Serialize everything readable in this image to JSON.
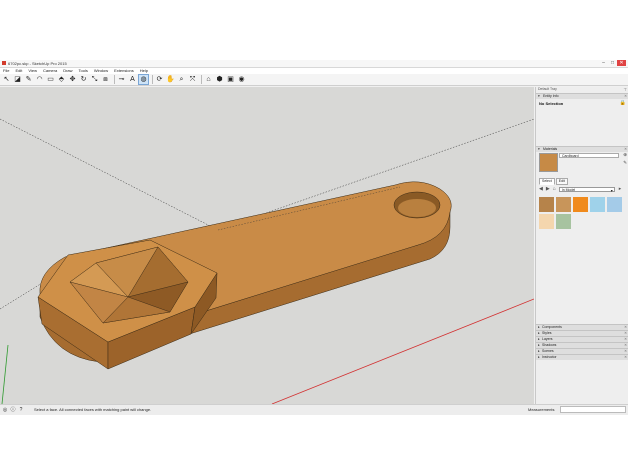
{
  "window": {
    "title": "6702pc.skp - SketchUp Pro 2015",
    "minimize": "–",
    "maximize": "□",
    "close": "✕"
  },
  "menu": [
    "File",
    "Edit",
    "View",
    "Camera",
    "Draw",
    "Tools",
    "Window",
    "Extensions",
    "Help"
  ],
  "toolbar": {
    "tools": [
      {
        "icon": "select-arrow-icon",
        "glyph": "↖"
      },
      {
        "icon": "eraser-icon",
        "glyph": "◪"
      },
      {
        "icon": "line-pencil-icon",
        "glyph": "✎"
      },
      {
        "icon": "arc-icon",
        "glyph": "◠"
      },
      {
        "icon": "rectangle-icon",
        "glyph": "▭"
      },
      {
        "icon": "push-pull-icon",
        "glyph": "⬘"
      },
      {
        "icon": "move-icon",
        "glyph": "✥"
      },
      {
        "icon": "rotate-icon",
        "glyph": "↻"
      },
      {
        "icon": "scale-icon",
        "glyph": "⤡"
      },
      {
        "icon": "offset-icon",
        "glyph": "⧈"
      },
      {
        "icon": "tape-measure-icon",
        "glyph": "⊸"
      },
      {
        "icon": "text-icon",
        "glyph": "A"
      },
      {
        "icon": "paint-bucket-icon",
        "glyph": "◍"
      },
      {
        "icon": "orbit-icon",
        "glyph": "⟳"
      },
      {
        "icon": "pan-icon",
        "glyph": "✋"
      },
      {
        "icon": "zoom-icon",
        "glyph": "⌕"
      },
      {
        "icon": "zoom-extents-icon",
        "glyph": "⤧"
      },
      {
        "icon": "warehouse-icon",
        "glyph": "⌂"
      },
      {
        "icon": "extension-warehouse-icon",
        "glyph": "⬢"
      },
      {
        "icon": "send-to-layout-icon",
        "glyph": "▣"
      },
      {
        "icon": "extension-manager-icon",
        "glyph": "◉"
      }
    ]
  },
  "tray": {
    "title": "Default Tray",
    "pin_icon": "pin-icon",
    "entity_info": {
      "label": "Entity Info",
      "value": "No Selection"
    },
    "materials": {
      "label": "Materials",
      "name": "Cardboard",
      "tabs": [
        "Select",
        "Edit"
      ],
      "collection": "In Model",
      "dropdown_arrow": "▾",
      "swatches": [
        "#b6834a",
        "#c8955a",
        "#f08a1c",
        "#9fd2ea",
        "#a4cbe8",
        "#f4d6ae",
        "#a7c3a0"
      ]
    },
    "panels": [
      "Components",
      "Styles",
      "Layers",
      "Shadows",
      "Scenes",
      "Instructor"
    ]
  },
  "status": {
    "message": "Select a face.  All connected faces with matching paint will change.",
    "measurements_label": "Measurements"
  },
  "colors": {
    "model_face": "#c98b47",
    "model_side": "#a26a2e",
    "viewport_bg": "#d8d8d6"
  }
}
